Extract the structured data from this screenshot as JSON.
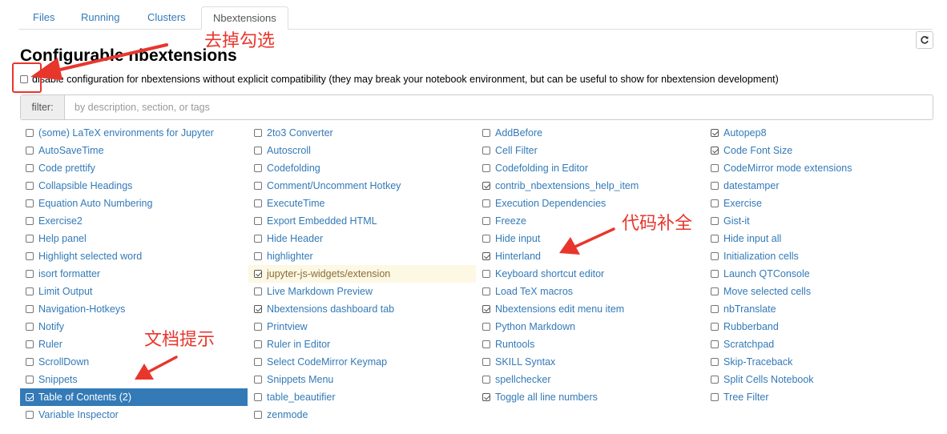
{
  "tabs": [
    {
      "label": "Files",
      "active": false
    },
    {
      "label": "Running",
      "active": false
    },
    {
      "label": "Clusters",
      "active": false
    },
    {
      "label": "Nbextensions",
      "active": true
    }
  ],
  "refresh_icon": "refresh-icon",
  "page_title": "Configurable nbextensions",
  "compat": {
    "checked": false,
    "label": "disable configuration for nbextensions without explicit compatibility (they may break your notebook environment, but can be useful to show for nbextension development)"
  },
  "filter": {
    "label": "filter:",
    "placeholder": "by description, section, or tags",
    "value": ""
  },
  "columns": [
    [
      {
        "label": "(some) LaTeX environments for Jupyter",
        "checked": false
      },
      {
        "label": "AutoSaveTime",
        "checked": false
      },
      {
        "label": "Code prettify",
        "checked": false
      },
      {
        "label": "Collapsible Headings",
        "checked": false
      },
      {
        "label": "Equation Auto Numbering",
        "checked": false
      },
      {
        "label": "Exercise2",
        "checked": false
      },
      {
        "label": "Help panel",
        "checked": false
      },
      {
        "label": "Highlight selected word",
        "checked": false
      },
      {
        "label": "isort formatter",
        "checked": false
      },
      {
        "label": "Limit Output",
        "checked": false
      },
      {
        "label": "Navigation-Hotkeys",
        "checked": false
      },
      {
        "label": "Notify",
        "checked": false
      },
      {
        "label": "Ruler",
        "checked": false
      },
      {
        "label": "ScrollDown",
        "checked": false
      },
      {
        "label": "Snippets",
        "checked": false
      },
      {
        "label": "Table of Contents (2)",
        "checked": true,
        "state": "selected"
      },
      {
        "label": "Variable Inspector",
        "checked": false
      }
    ],
    [
      {
        "label": "2to3 Converter",
        "checked": false
      },
      {
        "label": "Autoscroll",
        "checked": false
      },
      {
        "label": "Codefolding",
        "checked": false
      },
      {
        "label": "Comment/Uncomment Hotkey",
        "checked": false
      },
      {
        "label": "ExecuteTime",
        "checked": false
      },
      {
        "label": "Export Embedded HTML",
        "checked": false
      },
      {
        "label": "Hide Header",
        "checked": false
      },
      {
        "label": "highlighter",
        "checked": false
      },
      {
        "label": "jupyter-js-widgets/extension",
        "checked": true,
        "state": "warning"
      },
      {
        "label": "Live Markdown Preview",
        "checked": false
      },
      {
        "label": "Nbextensions dashboard tab",
        "checked": true
      },
      {
        "label": "Printview",
        "checked": false
      },
      {
        "label": "Ruler in Editor",
        "checked": false
      },
      {
        "label": "Select CodeMirror Keymap",
        "checked": false
      },
      {
        "label": "Snippets Menu",
        "checked": false
      },
      {
        "label": "table_beautifier",
        "checked": false
      },
      {
        "label": "zenmode",
        "checked": false
      }
    ],
    [
      {
        "label": "AddBefore",
        "checked": false
      },
      {
        "label": "Cell Filter",
        "checked": false
      },
      {
        "label": "Codefolding in Editor",
        "checked": false
      },
      {
        "label": "contrib_nbextensions_help_item",
        "checked": true
      },
      {
        "label": "Execution Dependencies",
        "checked": false
      },
      {
        "label": "Freeze",
        "checked": false
      },
      {
        "label": "Hide input",
        "checked": false
      },
      {
        "label": "Hinterland",
        "checked": true
      },
      {
        "label": "Keyboard shortcut editor",
        "checked": false
      },
      {
        "label": "Load TeX macros",
        "checked": false
      },
      {
        "label": "Nbextensions edit menu item",
        "checked": true
      },
      {
        "label": "Python Markdown",
        "checked": false
      },
      {
        "label": "Runtools",
        "checked": false
      },
      {
        "label": "SKILL Syntax",
        "checked": false
      },
      {
        "label": "spellchecker",
        "checked": false
      },
      {
        "label": "Toggle all line numbers",
        "checked": true
      }
    ],
    [
      {
        "label": "Autopep8",
        "checked": true
      },
      {
        "label": "Code Font Size",
        "checked": true
      },
      {
        "label": "CodeMirror mode extensions",
        "checked": false
      },
      {
        "label": "datestamper",
        "checked": false
      },
      {
        "label": "Exercise",
        "checked": false
      },
      {
        "label": "Gist-it",
        "checked": false
      },
      {
        "label": "Hide input all",
        "checked": false
      },
      {
        "label": "Initialization cells",
        "checked": false
      },
      {
        "label": "Launch QTConsole",
        "checked": false
      },
      {
        "label": "Move selected cells",
        "checked": false
      },
      {
        "label": "nbTranslate",
        "checked": false
      },
      {
        "label": "Rubberband",
        "checked": false
      },
      {
        "label": "Scratchpad",
        "checked": false
      },
      {
        "label": "Skip-Traceback",
        "checked": false
      },
      {
        "label": "Split Cells Notebook",
        "checked": false
      },
      {
        "label": "Tree Filter",
        "checked": false
      }
    ]
  ],
  "annotations": {
    "uncheck": "去掉勾选",
    "autocomplete": "代码补全",
    "doc_hint": "文档提示",
    "color": "#e8362d"
  },
  "colors": {
    "link": "#337ab7",
    "selected_bg": "#337ab7",
    "warning_bg": "#fcf8e3",
    "annotation": "#e8362d"
  }
}
